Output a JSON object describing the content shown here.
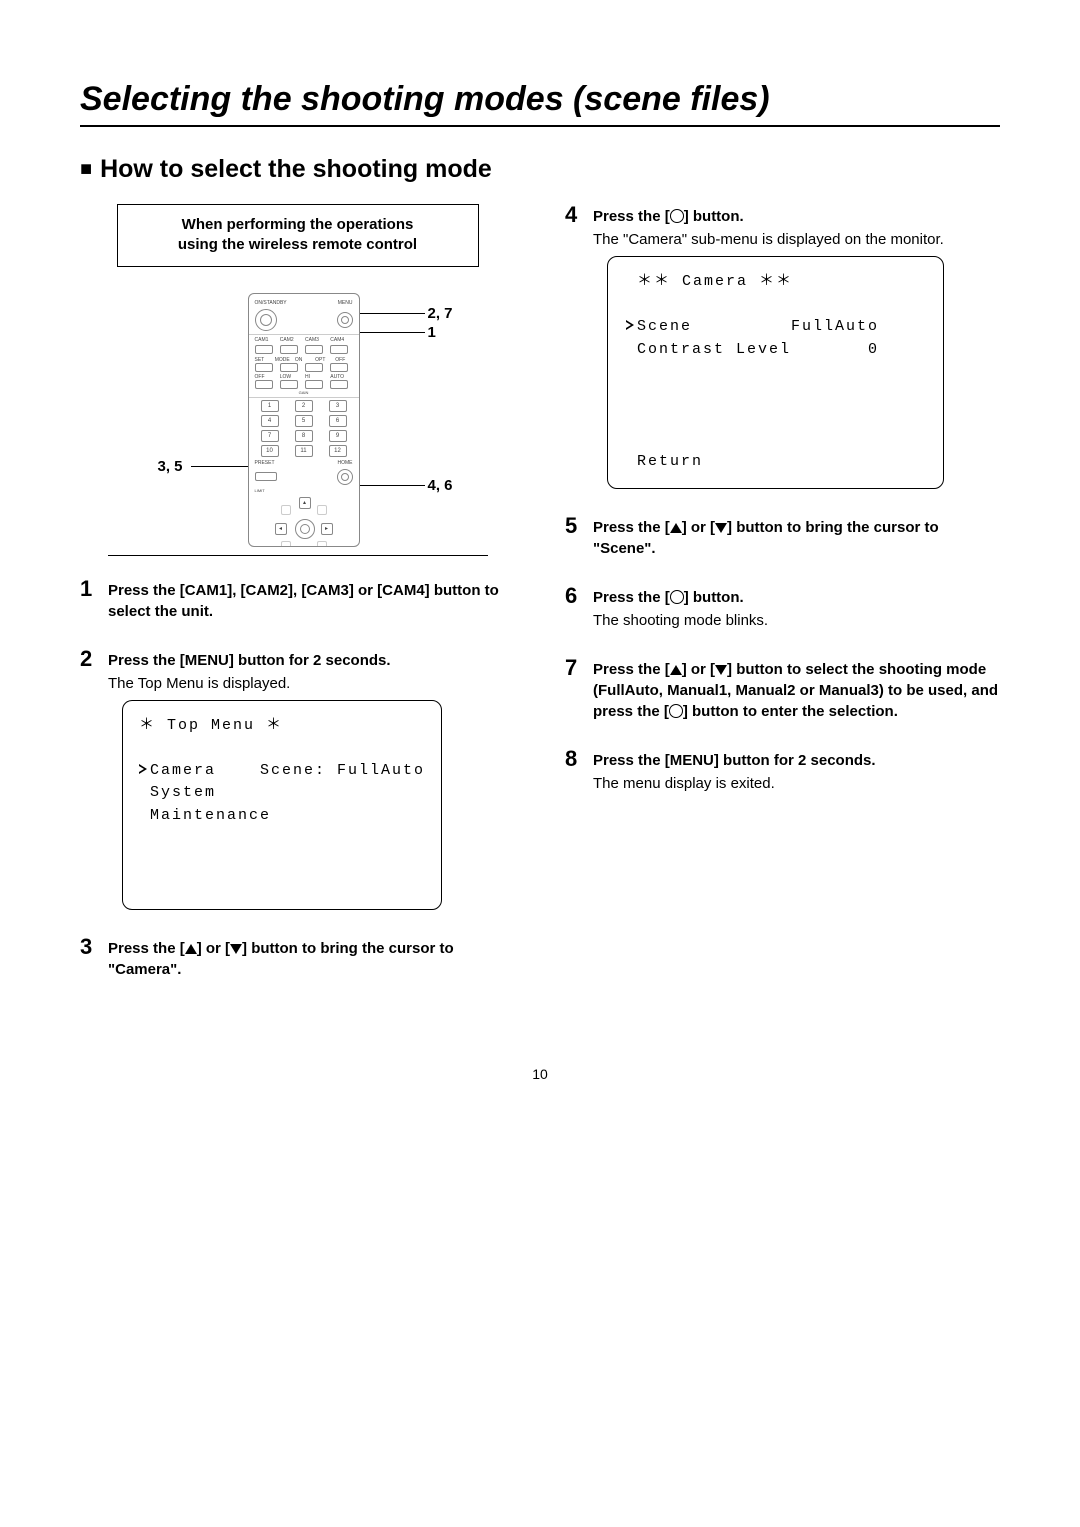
{
  "title": "Selecting the shooting modes (scene files)",
  "section": "How to select the shooting mode",
  "note_l1": "When performing the operations",
  "note_l2": "using the wireless remote control",
  "callouts": {
    "top_right1": "2, 7",
    "top_right2": "1",
    "left": "3, 5",
    "bottom_right": "4, 6"
  },
  "remote": {
    "on_standby": "ON/STANDBY",
    "menu": "MENU",
    "cams": [
      "CAM1",
      "CAM2",
      "CAM3",
      "CAM4"
    ],
    "row2": [
      "SET",
      "MODE",
      "ON",
      "OPT",
      "OFF"
    ],
    "row3": [
      "OFF",
      "LOW",
      "HI",
      "AUTO"
    ],
    "gain": "GAIN",
    "nums": [
      "1",
      "2",
      "3",
      "4",
      "5",
      "6",
      "7",
      "8",
      "9",
      "10",
      "11",
      "12"
    ],
    "preset": "PRESET",
    "home": "HOME",
    "limit": "LIMIT"
  },
  "steps_left": [
    {
      "n": "1",
      "bold": "Press the [CAM1], [CAM2], [CAM3] or [CAM4] button to select the unit."
    },
    {
      "n": "2",
      "bold": "Press the [MENU] button for 2 seconds.",
      "detail": "The Top Menu is displayed."
    }
  ],
  "step3": {
    "n": "3",
    "bold_a": "Press the [",
    "bold_b": "] or [",
    "bold_c": "] button to bring the cursor to \"Camera\"."
  },
  "top_menu": {
    "title": " Top Menu ",
    "l1a": "Camera",
    "l1b": "Scene: FullAuto",
    "l2": " System",
    "l3": " Maintenance"
  },
  "steps_right": {
    "s4": {
      "n": "4",
      "bold": "Press the [",
      "bold2": "] button.",
      "detail": "The \"Camera\" sub-menu is displayed on the monitor."
    },
    "s5": {
      "n": "5",
      "bold_a": "Press the [",
      "bold_b": "] or [",
      "bold_c": "] button to bring the cursor to \"Scene\"."
    },
    "s6": {
      "n": "6",
      "bold": "Press the [",
      "bold2": "] button.",
      "detail": "The shooting mode blinks."
    },
    "s7": {
      "n": "7",
      "bold_a": "Press the [",
      "bold_b": "] or [",
      "bold_c": "] button to select the shooting mode (FullAuto, Manual1, Manual2 or Manual3) to be used, and press the [",
      "bold_d": "] button to enter the selection."
    },
    "s8": {
      "n": "8",
      "bold": "Press the [MENU] button for 2 seconds.",
      "detail": "The menu display is exited."
    }
  },
  "camera_menu": {
    "title": " Camera ",
    "l1a": "Scene",
    "l1b": "FullAuto",
    "l2a": " Contrast Level",
    "l2b": "0",
    "ret": " Return"
  },
  "page_number": "10"
}
